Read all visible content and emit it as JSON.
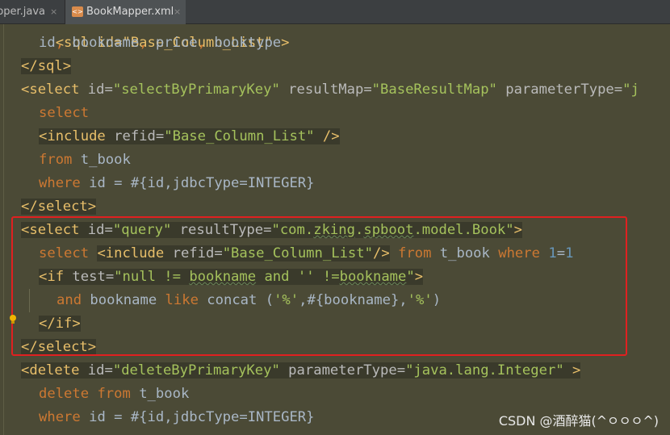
{
  "tabs": [
    {
      "label": "pper.java",
      "close": "×"
    },
    {
      "label": "BookMapper.xml",
      "close": "×",
      "icon": "xml-file-icon",
      "active": true
    }
  ],
  "code": {
    "line0": {
      "t1": "<sql id=\"Base_Column_List\" >"
    },
    "line1": {
      "t1": "id",
      "t2": ", ",
      "t3": "bookname",
      "t4": ", ",
      "t5": "price",
      "t6": ", ",
      "t7": "booktype"
    },
    "line2": {
      "t1": "</sql>"
    },
    "line3": {
      "t1": "<select ",
      "t2": "id",
      "t3": "=",
      "t4": "\"selectByPrimaryKey\"",
      "t5": " resultMap",
      "t6": "=",
      "t7": "\"BaseResultMap\"",
      "t8": " parameterType",
      "t9": "=",
      "t10": "\"j"
    },
    "line4": {
      "t1": "select"
    },
    "line5": {
      "t1": "<include ",
      "t2": "refid",
      "t3": "=",
      "t4": "\"Base_Column_List\"",
      "t5": " />"
    },
    "line6": {
      "t1": "from",
      "t2": " t_book"
    },
    "line7": {
      "t1": "where",
      "t2": " id = #{id,jdbcType=INTEGER}"
    },
    "line8": {
      "t1": "</select>"
    },
    "line9": {
      "t1": "<select ",
      "t2": "id",
      "t3": "=",
      "t4": "\"query\"",
      "t5": " resultType",
      "t6": "=",
      "t7": "\"com.",
      "t8": "zking",
      "t9": ".",
      "t10": "spboot",
      "t11": ".model.Book\"",
      "t12": ">"
    },
    "line10": {
      "t1": "select",
      "t2": " ",
      "t3": "<include ",
      "t4": "refid",
      "t5": "=",
      "t6": "\"Base_Column_List\"",
      "t7": "/>",
      "t8": " ",
      "t9": "from",
      "t10": " t_book ",
      "t11": "where",
      "t12": " ",
      "t13": "1",
      "t14": "=",
      "t15": "1"
    },
    "line11": {
      "t1": "<if ",
      "t2": "test",
      "t3": "=",
      "t4": "\"null != ",
      "t5": "bookname",
      "t6": " and '' !=",
      "t7": "bookname",
      "t8": "\"",
      "t9": ">"
    },
    "line12": {
      "t1": "and",
      "t2": " bookname ",
      "t3": "like",
      "t4": " concat (",
      "t5": "'%'",
      "t6": ",#{bookname},",
      "t7": "'%'",
      "t8": ")"
    },
    "line13": {
      "t1": "</if>"
    },
    "line14": {
      "t1": "</select>"
    },
    "line15": {
      "t1": "<delete ",
      "t2": "id",
      "t3": "=",
      "t4": "\"deleteByPrimaryKey\"",
      "t5": " parameterType",
      "t6": "=",
      "t7": "\"java.lang.Integer\"",
      "t8": " >"
    },
    "line16": {
      "t1": "delete",
      "t2": " ",
      "t3": "from",
      "t4": " t_book"
    },
    "line17": {
      "t1": "where",
      "t2": " id = #{id,jdbcType=INTEGER}"
    }
  },
  "watermark": "CSDN @酒醉猫(^ㅇㅇㅇ^)",
  "colors": {
    "highlight_box": "#e02020",
    "tag": "#e8bf6a",
    "string": "#a5c25c",
    "keyword": "#cc7832",
    "number": "#6897bb"
  }
}
